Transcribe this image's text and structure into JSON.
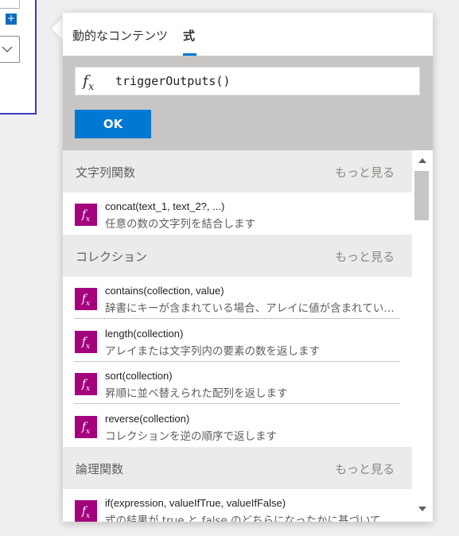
{
  "tabs": {
    "dynamic_content": "動的なコンテンツ",
    "expression": "式"
  },
  "expression": {
    "value": "triggerOutputs()",
    "fx_icon": "function-icon"
  },
  "ok_button": "OK",
  "colors": {
    "accent": "#0078d4",
    "function_icon_bg": "#a4007e",
    "category_bg": "#edebe9",
    "expression_panel_bg": "#c8c6c4"
  },
  "categories": [
    {
      "label": "文字列関数",
      "more": "もっと見る",
      "functions": [
        {
          "name": "concat(text_1, text_2?, ...)",
          "desc": "任意の数の文字列を結合します"
        }
      ]
    },
    {
      "label": "コレクション",
      "more": "もっと見る",
      "functions": [
        {
          "name": "contains(collection, value)",
          "desc": "辞書にキーが含まれている場合、アレイに値が含まれている場合、文字列にサブ文字列が含まれている場合は true を返します"
        },
        {
          "name": "length(collection)",
          "desc": "アレイまたは文字列内の要素の数を返します"
        },
        {
          "name": "sort(collection)",
          "desc": "昇順に並べ替えられた配列を返します"
        },
        {
          "name": "reverse(collection)",
          "desc": "コレクションを逆の順序で返します"
        }
      ]
    },
    {
      "label": "論理関数",
      "more": "もっと見る",
      "functions": [
        {
          "name": "if(expression, valueIfTrue, valueIfFalse)",
          "desc": "式の結果が true と false のどちらになったかに基づいて、指定された値を返します"
        }
      ]
    }
  ]
}
